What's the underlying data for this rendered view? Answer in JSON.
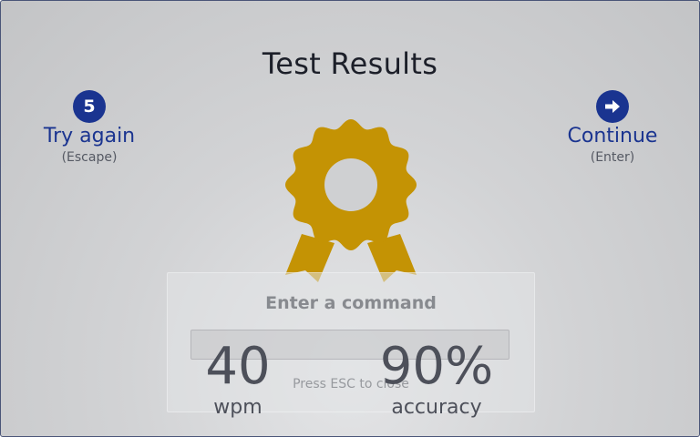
{
  "results": {
    "title": "Test Results",
    "try_again": {
      "badge": "5",
      "label": "Try again",
      "hint": "(Escape)"
    },
    "continue": {
      "icon": "arrow-right-icon",
      "label": "Continue",
      "hint": "(Enter)"
    },
    "award_icon": "award-ribbon-icon",
    "stats": {
      "wpm_value": "40",
      "wpm_label": "wpm",
      "accuracy_value": "90%",
      "accuracy_label": "accuracy"
    }
  },
  "command_palette": {
    "title": "Enter a command",
    "input_value": "",
    "hint": "Press ESC to close"
  },
  "colors": {
    "accent": "#1a3490",
    "award_gold": "#c49304",
    "text_dark": "#1c1f29",
    "text_muted": "#555963"
  }
}
